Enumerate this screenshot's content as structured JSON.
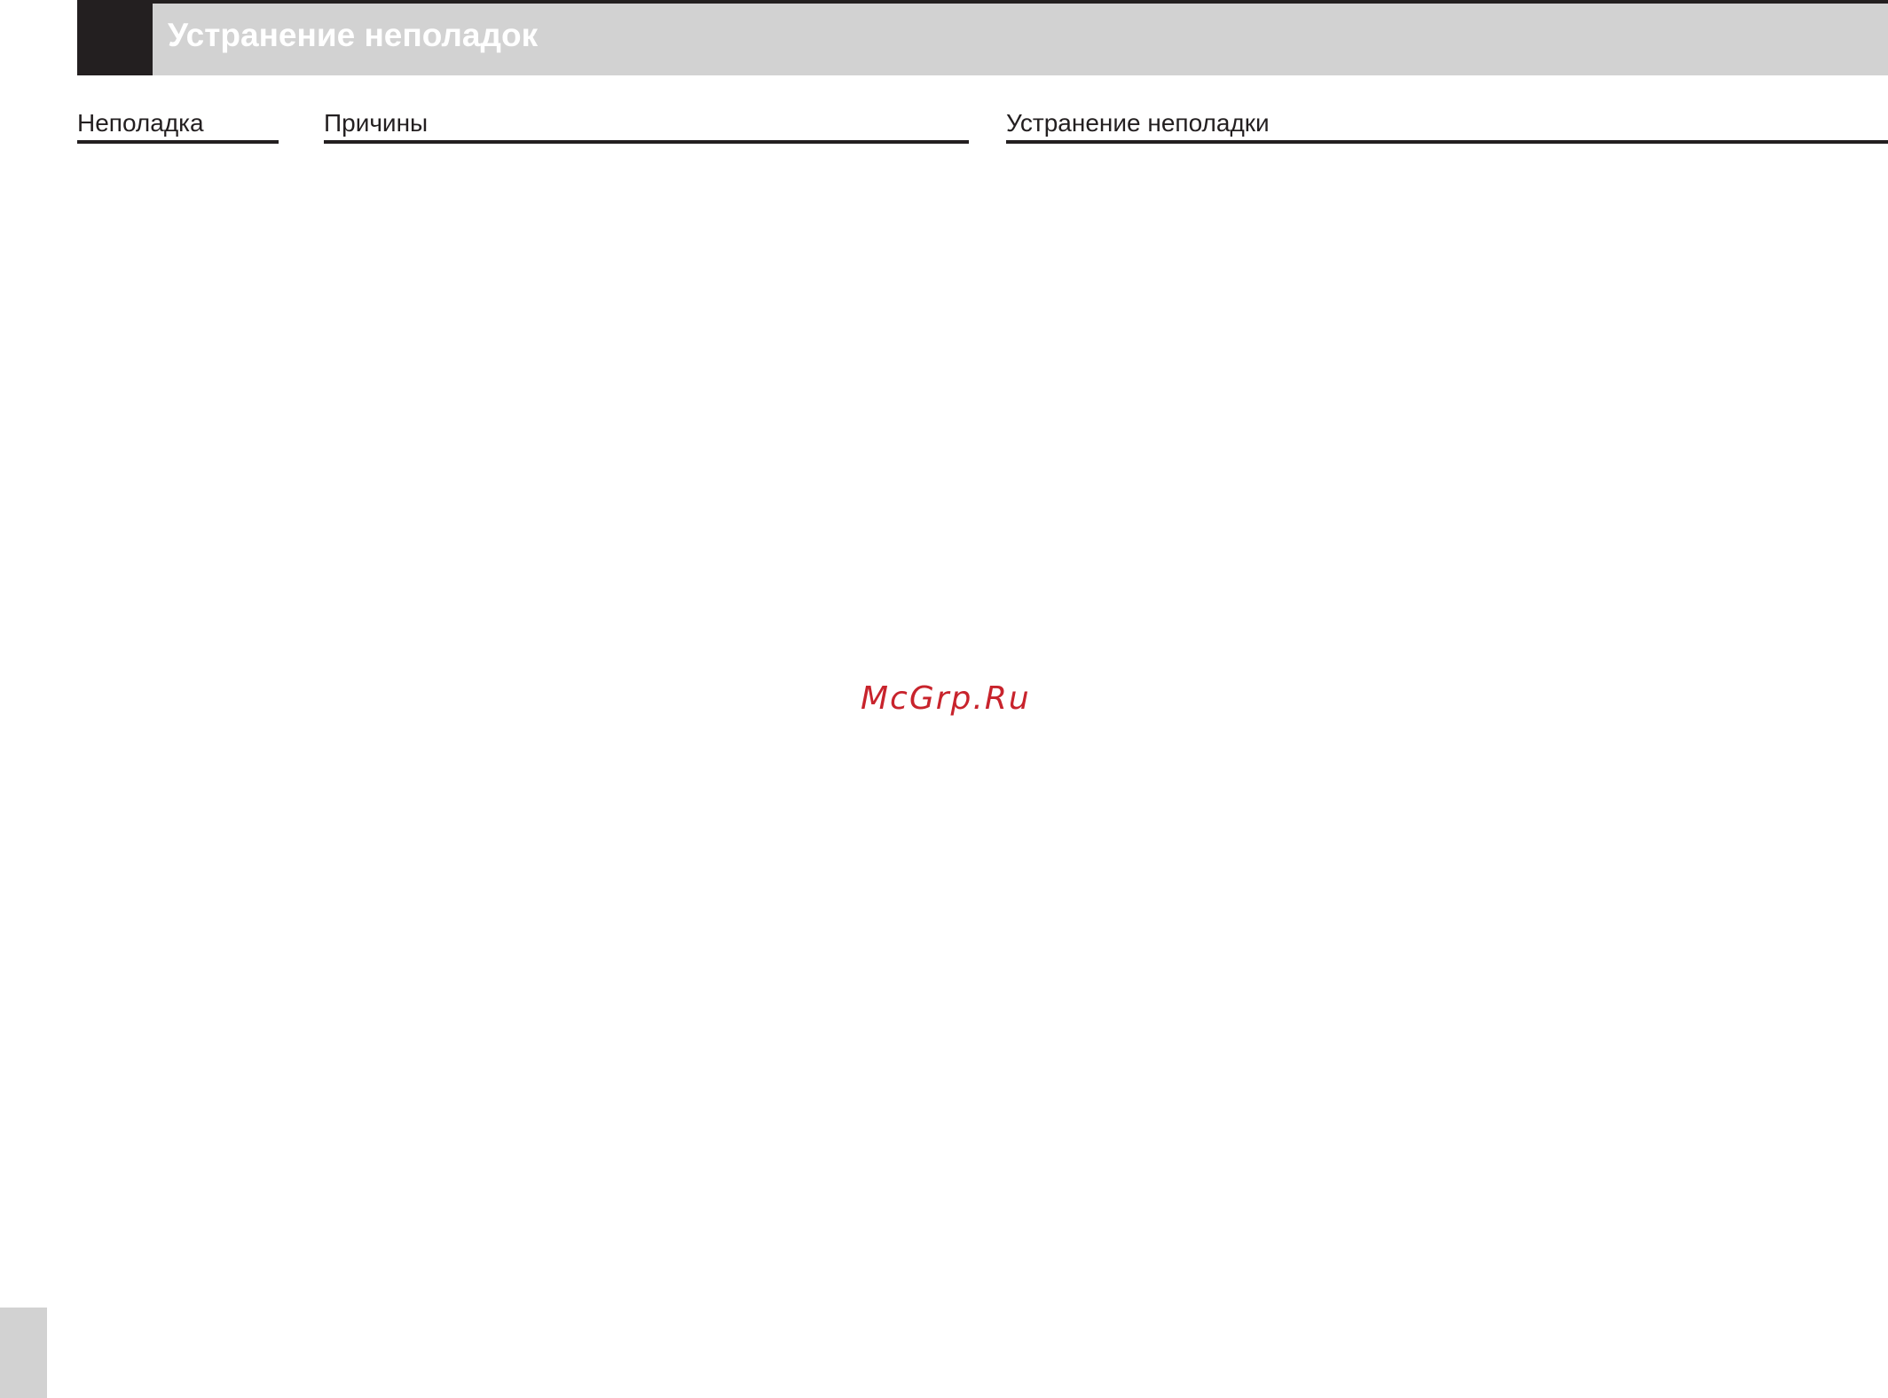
{
  "header": {
    "title": "Устранение неполадок"
  },
  "table": {
    "columns": [
      "Неполадка",
      "Причины",
      "Устранение неполадки"
    ]
  },
  "watermark": {
    "text": "McGrp.Ru"
  },
  "colors": {
    "rule": "#231f20",
    "band": "#d2d2d2",
    "watermark": "#c8232c"
  }
}
